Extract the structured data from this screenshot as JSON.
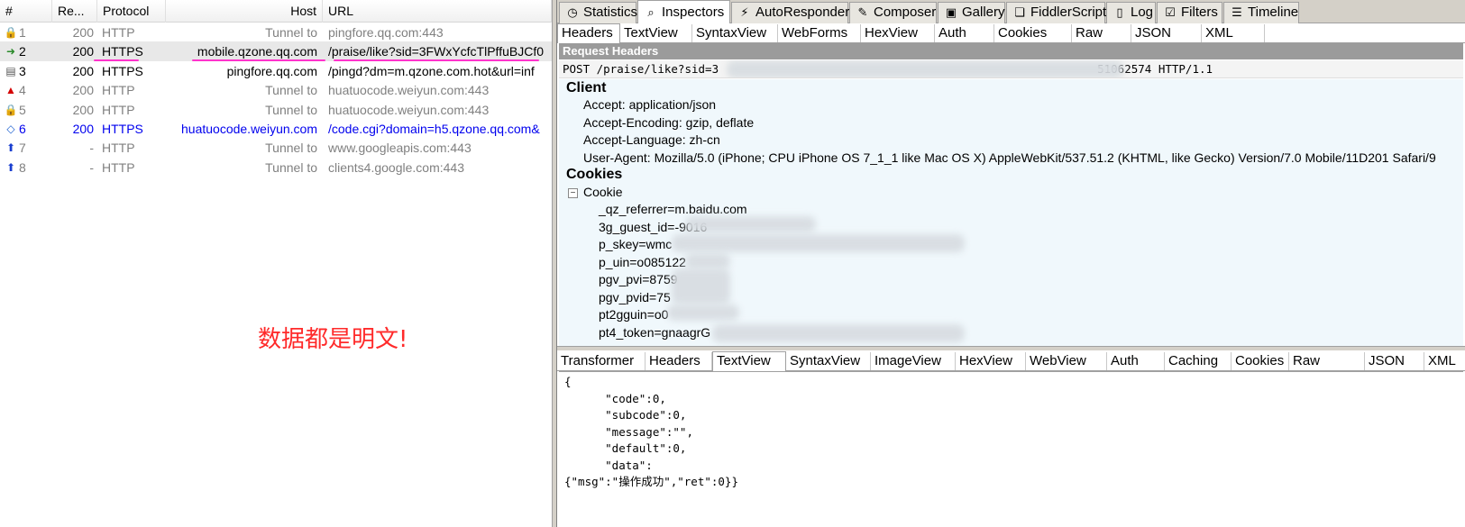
{
  "sessions_header": {
    "num": "#",
    "result": "Re...",
    "protocol": "Protocol",
    "host": "Host",
    "url": "URL"
  },
  "sessions": [
    {
      "num": "1",
      "result": "200",
      "protocol": "HTTP",
      "host": "Tunnel to",
      "url": "pingfore.qq.com:443",
      "icon": "lock-icon",
      "glyph": "🔒",
      "style": "gray"
    },
    {
      "num": "2",
      "result": "200",
      "protocol": "HTTPS",
      "host": "mobile.qzone.qq.com",
      "url": "/praise/like?sid=3FWxYcfcTlPffuBJCf0",
      "icon": "post-arrow-icon",
      "glyph": "➜",
      "style": "black"
    },
    {
      "num": "3",
      "result": "200",
      "protocol": "HTTPS",
      "host": "pingfore.qq.com",
      "url": "/pingd?dm=m.qzone.com.hot&url=inf",
      "icon": "document-icon",
      "glyph": "▤",
      "style": "black"
    },
    {
      "num": "4",
      "result": "200",
      "protocol": "HTTP",
      "host": "Tunnel to",
      "url": "huatuocode.weiyun.com:443",
      "icon": "warning-icon",
      "glyph": "▲",
      "style": "gray"
    },
    {
      "num": "5",
      "result": "200",
      "protocol": "HTTP",
      "host": "Tunnel to",
      "url": "huatuocode.weiyun.com:443",
      "icon": "lock-icon",
      "glyph": "🔒",
      "style": "gray"
    },
    {
      "num": "6",
      "result": "200",
      "protocol": "HTTPS",
      "host": "huatuocode.weiyun.com",
      "url": "/code.cgi?domain=h5.qzone.qq.com&",
      "icon": "script-icon",
      "glyph": "◇",
      "style": "blue"
    },
    {
      "num": "7",
      "result": "-",
      "protocol": "HTTP",
      "host": "Tunnel to",
      "url": "www.googleapis.com:443",
      "icon": "upload-arrow-icon",
      "glyph": "⬆",
      "style": "gray"
    },
    {
      "num": "8",
      "result": "-",
      "protocol": "HTTP",
      "host": "Tunnel to",
      "url": "clients4.google.com:443",
      "icon": "upload-arrow-icon",
      "glyph": "⬆",
      "style": "gray"
    }
  ],
  "annotation": "数据都是明文!",
  "main_tabs": [
    {
      "label": "Statistics",
      "icon": "stopwatch-icon",
      "glyph": "◷"
    },
    {
      "label": "Inspectors",
      "icon": "magnifier-icon",
      "glyph": "⌕",
      "active": true
    },
    {
      "label": "AutoResponder",
      "icon": "lightning-icon",
      "glyph": "⚡"
    },
    {
      "label": "Composer",
      "icon": "pencil-icon",
      "glyph": "✎"
    },
    {
      "label": "Gallery",
      "icon": "gallery-icon",
      "glyph": "▣"
    },
    {
      "label": "FiddlerScript",
      "icon": "script-icon",
      "glyph": "❏"
    },
    {
      "label": "Log",
      "icon": "log-icon",
      "glyph": "▯"
    },
    {
      "label": "Filters",
      "icon": "checkbox-icon",
      "glyph": "☑"
    },
    {
      "label": "Timeline",
      "icon": "timeline-icon",
      "glyph": "☰"
    }
  ],
  "request_tabs": [
    "Headers",
    "TextView",
    "SyntaxView",
    "WebForms",
    "HexView",
    "Auth",
    "Cookies",
    "Raw",
    "JSON",
    "XML"
  ],
  "request_headers_title": "Request Headers",
  "request_line": {
    "start": "POST /praise/like?sid=3",
    "end": "51062574 HTTP/1.1"
  },
  "client_group": "Client",
  "client_headers": [
    "Accept: application/json",
    "Accept-Encoding: gzip, deflate",
    "Accept-Language: zh-cn",
    "User-Agent: Mozilla/5.0 (iPhone; CPU iPhone OS 7_1_1 like Mac OS X) AppleWebKit/537.51.2 (KHTML, like Gecko) Version/7.0 Mobile/11D201 Safari/9"
  ],
  "cookies_group": "Cookies",
  "cookie_label": "Cookie",
  "cookie_expander": "−",
  "cookies": [
    "_qz_referrer=m.baidu.com",
    "3g_guest_id=-9016",
    "p_skey=wmc",
    "p_uin=o085122",
    "pgv_pvi=8759",
    "pgv_pvid=75",
    "pt2gguin=o0",
    "pt4_token=gnaagrG"
  ],
  "response_tabs": [
    "Transformer",
    "Headers",
    "TextView",
    "SyntaxView",
    "ImageView",
    "HexView",
    "WebView",
    "Auth",
    "Caching",
    "Cookies",
    "Raw",
    "JSON",
    "XML"
  ],
  "response_body": "{\n      \"code\":0,\n      \"subcode\":0,\n      \"message\":\"\",\n      \"default\":0,\n      \"data\":\n{\"msg\":\"操作成功\",\"ret\":0}}",
  "colors": {
    "annotation": "#ff2a2a",
    "underline": "#ff33cc",
    "link_blue": "#0000ee",
    "headers_bar": "#9b9b9b"
  }
}
